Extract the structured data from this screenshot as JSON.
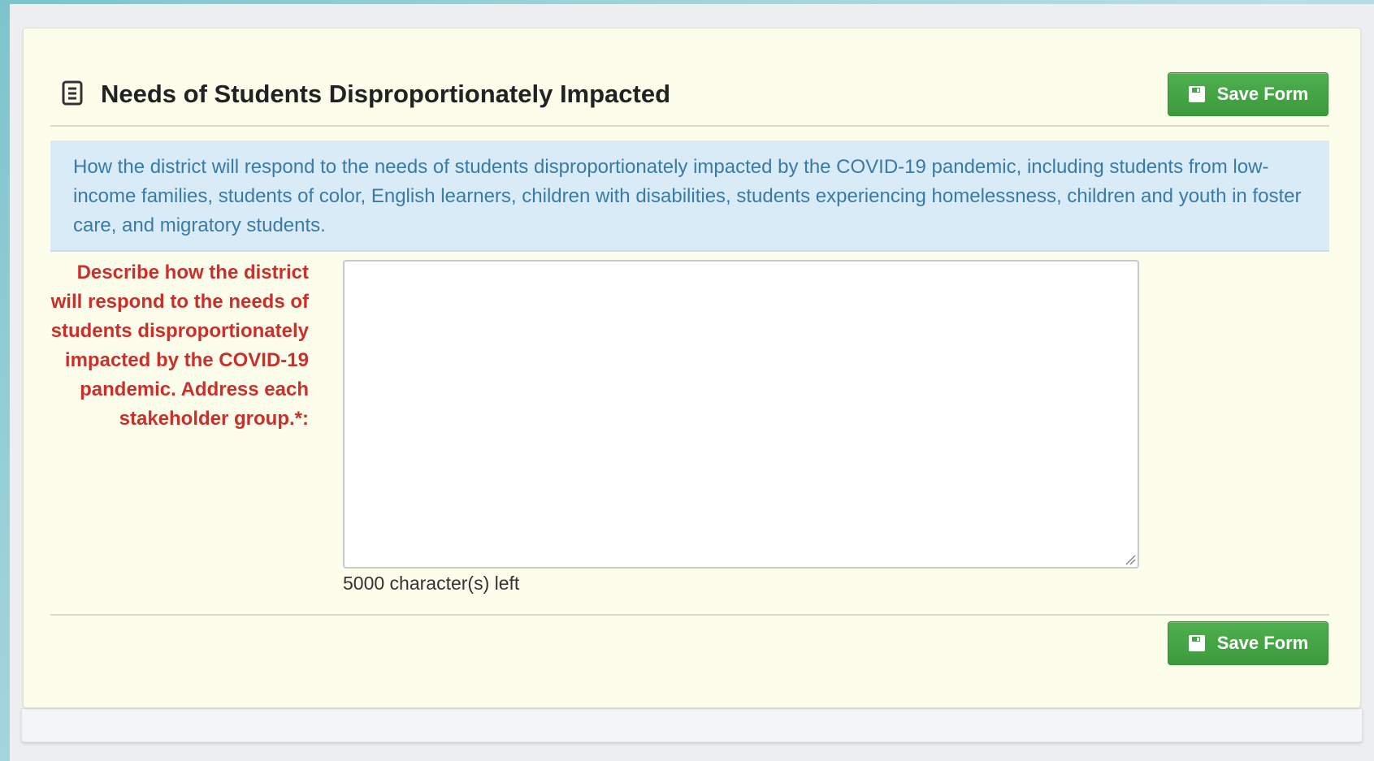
{
  "section": {
    "title": "Needs of Students Disproportionately Impacted",
    "title_icon": "document-list-icon",
    "info_text": "How the district will respond to the needs of students disproportionately impacted by the COVID-19 pandemic, including students from low-income families, students of color, English learners, children with disabilities, students experiencing homelessness, children and youth in foster care, and migratory students."
  },
  "buttons": {
    "save_top_label": "Save Form",
    "save_bottom_label": "Save Form",
    "save_icon": "floppy-disk-icon"
  },
  "form": {
    "field_label": "Describe how the district will respond to the needs of students disproportionately impacted by the COVID-19 pandemic. Address each stakeholder group.*:",
    "field_value": "",
    "char_count": "5000 character(s) left"
  },
  "colors": {
    "button_green": "#43a543",
    "label_red": "#c9302c",
    "info_blue_text": "#3a7aa6",
    "info_blue_bg": "#d8ebf6",
    "panel_bg": "#fdfdec"
  }
}
